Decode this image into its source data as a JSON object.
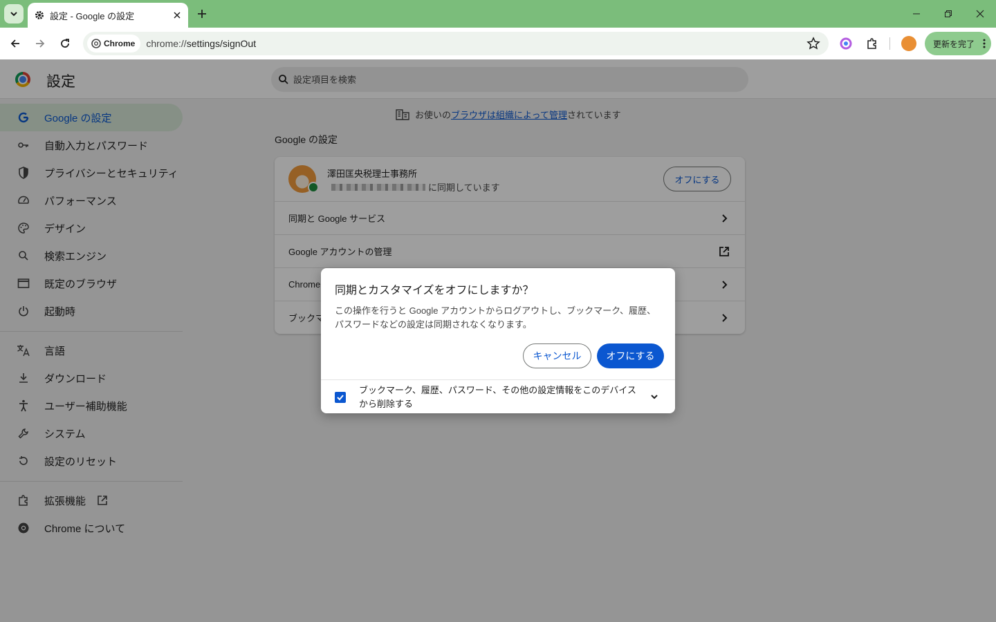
{
  "browser": {
    "tab_title": "設定 - Google の設定",
    "chip_label": "Chrome",
    "url_prefix": "chrome://",
    "url_path": "settings/signOut",
    "update_label": "更新を完了"
  },
  "header": {
    "title": "設定",
    "search_placeholder": "設定項目を検索"
  },
  "sidebar": {
    "items": [
      {
        "label": "Google の設定",
        "icon": "google-g-icon"
      },
      {
        "label": "自動入力とパスワード",
        "icon": "key-icon"
      },
      {
        "label": "プライバシーとセキュリティ",
        "icon": "shield-icon"
      },
      {
        "label": "パフォーマンス",
        "icon": "speedometer-icon"
      },
      {
        "label": "デザイン",
        "icon": "palette-icon"
      },
      {
        "label": "検索エンジン",
        "icon": "search-icon"
      },
      {
        "label": "既定のブラウザ",
        "icon": "browser-window-icon"
      },
      {
        "label": "起動時",
        "icon": "power-icon"
      },
      {
        "label": "言語",
        "icon": "translate-icon"
      },
      {
        "label": "ダウンロード",
        "icon": "download-icon"
      },
      {
        "label": "ユーザー補助機能",
        "icon": "accessibility-icon"
      },
      {
        "label": "システム",
        "icon": "wrench-icon"
      },
      {
        "label": "設定のリセット",
        "icon": "reset-icon"
      },
      {
        "label": "拡張機能",
        "icon": "puzzle-icon"
      },
      {
        "label": "Chrome について",
        "icon": "chrome-icon"
      }
    ]
  },
  "main": {
    "managed_prefix": "お使いの",
    "managed_link": "ブラウザは組織によって管理",
    "managed_suffix": "されています",
    "section_title": "Google の設定",
    "account_name": "澤田匡央税理士事務所",
    "account_sync_text": "に同期しています",
    "turn_off_label": "オフにする",
    "rows": [
      "同期と Google サービス",
      "Google アカウントの管理",
      "Chrome",
      "ブックマ"
    ]
  },
  "dialog": {
    "title": "同期とカスタマイズをオフにしますか？",
    "body": "この操作を行うと Google アカウントからログアウトし、ブックマーク、履歴、パスワードなどの設定は同期されなくなります。",
    "cancel_label": "キャンセル",
    "confirm_label": "オフにする",
    "checkbox_label": "ブックマーク、履歴、パスワード、その他の設定情報をこのデバイスから削除する",
    "checkbox_checked": true
  },
  "colors": {
    "frame": "#7bbd7b",
    "accent": "#0b57d0",
    "active_nav": "#d8e9d8"
  }
}
